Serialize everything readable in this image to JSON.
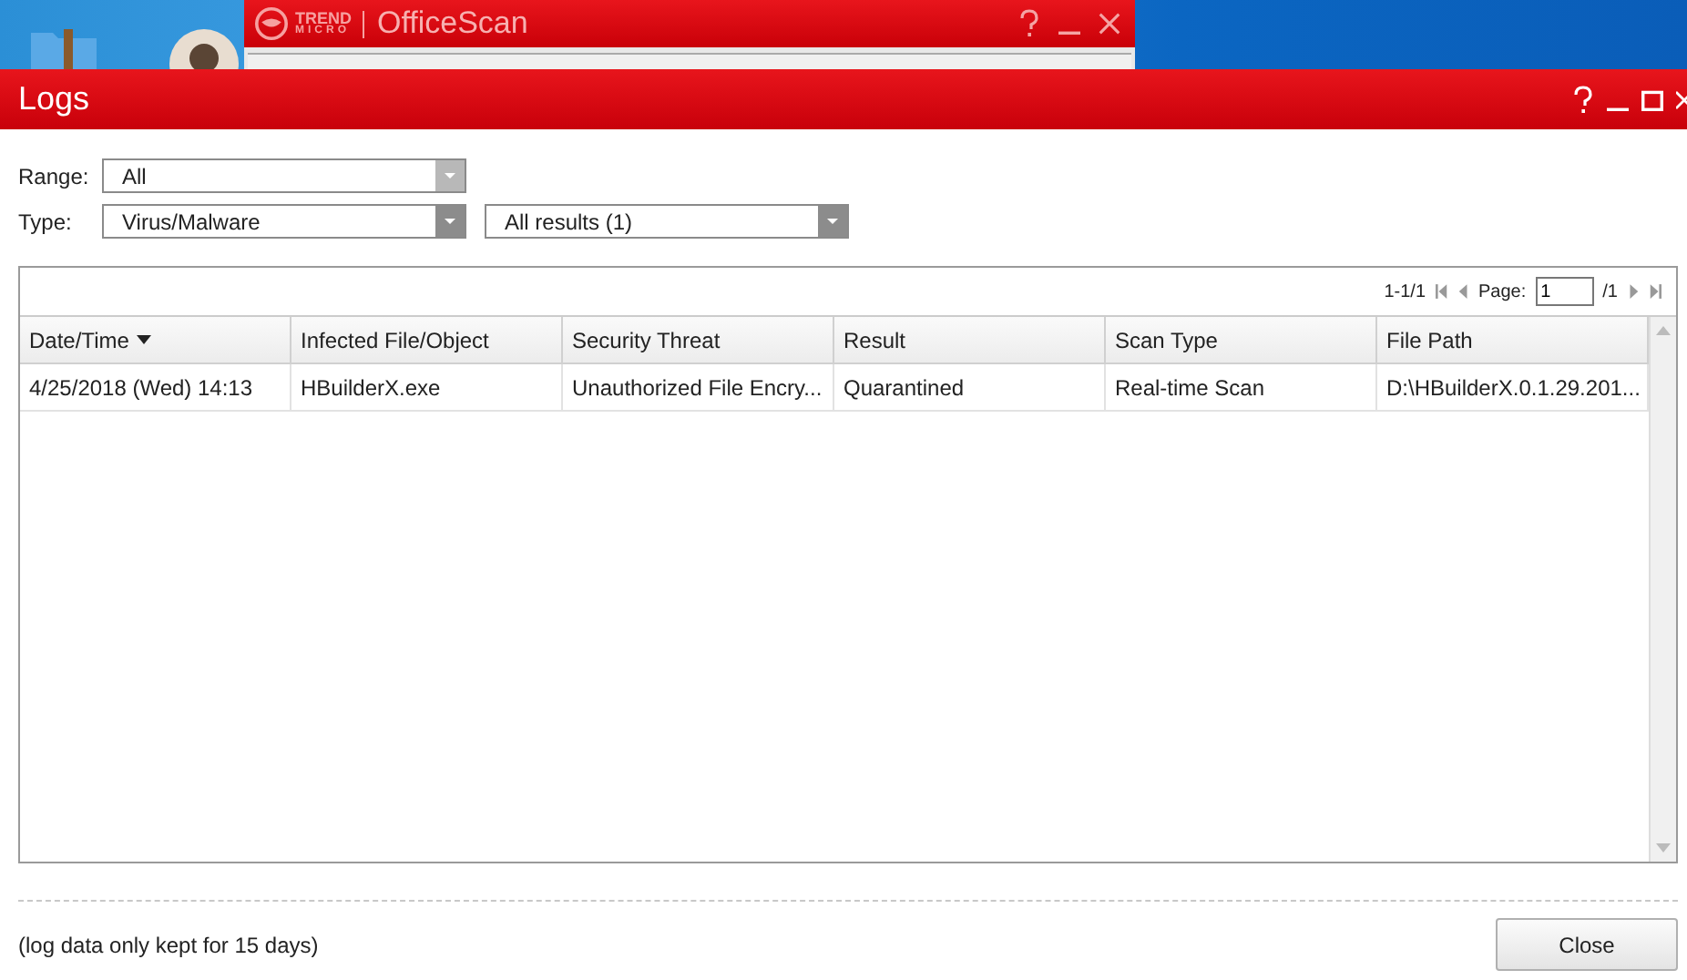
{
  "background_window": {
    "brand_top": "TREND",
    "brand_bottom": "MICRO",
    "title": "OfficeScan"
  },
  "window": {
    "title": "Logs"
  },
  "filters": [
    {
      "label": "Range:",
      "selects": [
        "All"
      ]
    },
    {
      "label": "Type:",
      "selects": [
        "Virus/Malware",
        "All results (1)"
      ]
    }
  ],
  "pager": {
    "range": "1-1/1",
    "page_label": "Page:",
    "page": "1",
    "total": "/1"
  },
  "table": {
    "columns": [
      {
        "label": "Date/Time",
        "sorted": true
      },
      {
        "label": "Infected File/Object",
        "sorted": false
      },
      {
        "label": "Security Threat",
        "sorted": false
      },
      {
        "label": "Result",
        "sorted": false
      },
      {
        "label": "Scan Type",
        "sorted": false
      },
      {
        "label": "File Path",
        "sorted": false
      }
    ],
    "rows": [
      [
        "4/25/2018 (Wed) 14:13",
        "HBuilderX.exe",
        "Unauthorized File Encry...",
        "Quarantined",
        "Real-time Scan",
        "D:\\HBuilderX.0.1.29.201..."
      ]
    ]
  },
  "footer": {
    "note": "(log data only kept for 15 days)",
    "button": "Close"
  }
}
